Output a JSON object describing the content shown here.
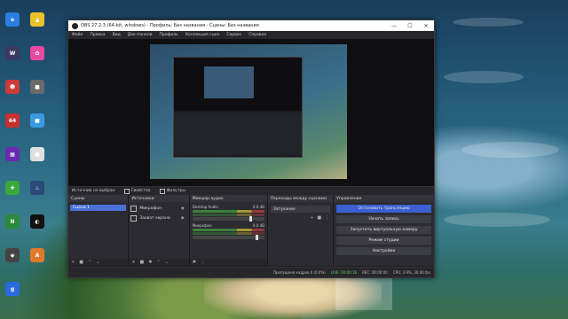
{
  "desktop": {
    "icons": [
      {
        "label": "",
        "color": "#2a7de1",
        "glyph": "e"
      },
      {
        "label": "",
        "color": "#e8c22a",
        "glyph": "▲"
      },
      {
        "label": "",
        "color": "#3a3a60",
        "glyph": "W"
      },
      {
        "label": "",
        "color": "#e84aa0",
        "glyph": "✿"
      },
      {
        "label": "",
        "color": "#cc3a3a",
        "glyph": "☻"
      },
      {
        "label": "",
        "color": "#6a6a6a",
        "glyph": "■"
      },
      {
        "label": "",
        "color": "#c83030",
        "glyph": "64"
      },
      {
        "label": "",
        "color": "#3a9ae0",
        "glyph": "■"
      },
      {
        "label": "",
        "color": "#6a2ab0",
        "glyph": "▦"
      },
      {
        "label": "",
        "color": "#e0e0e0",
        "glyph": "■"
      },
      {
        "label": "",
        "color": "#3aa83a",
        "glyph": "✚"
      },
      {
        "label": "",
        "color": "#2a4a7a",
        "glyph": "♨"
      },
      {
        "label": "",
        "color": "#2a8a3a",
        "glyph": "N"
      },
      {
        "label": "",
        "color": "#111111",
        "glyph": "◐"
      },
      {
        "label": "",
        "color": "#444444",
        "glyph": "◆"
      },
      {
        "label": "",
        "color": "#e07a2a",
        "glyph": "A"
      },
      {
        "label": "",
        "color": "#2a6ae0",
        "glyph": "g"
      }
    ]
  },
  "window": {
    "title": "OBS 27.2.3 (64-bit, windows) - Профиль: Без названия - Сцены: Без названия",
    "menu": [
      "Файл",
      "Правка",
      "Вид",
      "Док-панели",
      "Профиль",
      "Коллекция сцен",
      "Сервис",
      "Справка"
    ],
    "toolbar": {
      "no_source": "Источник не выбран",
      "properties": "Свойства",
      "filters": "Фильтры"
    },
    "docks": {
      "scenes": {
        "title": "Сцены",
        "items": [
          "Сцена 1"
        ]
      },
      "sources": {
        "title": "Источники",
        "items": [
          {
            "label": "Микрофон",
            "icon": "microphone-icon"
          },
          {
            "label": "Захват экрана",
            "icon": "monitor-icon"
          }
        ]
      },
      "mixer": {
        "title": "Микшер аудио",
        "channels": [
          {
            "name": "Desktop Audio",
            "db": "0.0 dB",
            "level": 0.82
          },
          {
            "name": "Микрофон",
            "db": "0.0 dB",
            "level": 0.9
          }
        ]
      },
      "transitions": {
        "title": "Переходы между сценами",
        "selected": "Затухание"
      },
      "controls": {
        "title": "Управление",
        "buttons": [
          "Остановить трансляцию",
          "Начать запись",
          "Запустить виртуальную камеру",
          "Режим студии",
          "Настройки"
        ]
      }
    },
    "status": {
      "dropped": "Пропущено кадров 0 (0.0%)",
      "live": "LIVE: 00:00:16",
      "rec": "REC: 00:00:00",
      "cpu": "CPU: 3.9%, 30.00 fps"
    }
  },
  "colors": {
    "accent": "#3b5fd0",
    "window_bg": "#1e1e22"
  }
}
